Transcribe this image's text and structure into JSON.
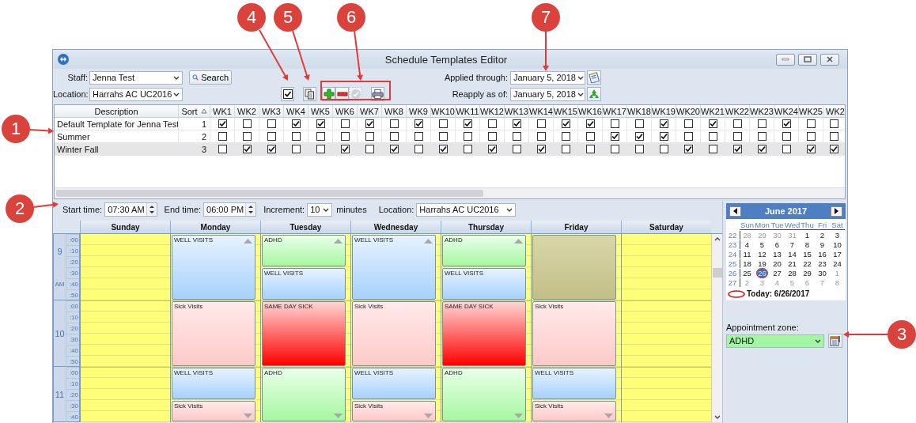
{
  "window": {
    "title": "Schedule Templates Editor"
  },
  "filters": {
    "staff_label": "Staff:",
    "staff": "Jenna Test",
    "search_button": "Search",
    "location_label": "Location:",
    "location": "Harrahs AC UC2016",
    "applied_label": "Applied through:",
    "applied_date": "January 5, 2018",
    "reapply_label": "Reapply as of:",
    "reapply_date": "January 5, 2018"
  },
  "toolbar": [
    {
      "kind": "checkbox",
      "disabled": false
    },
    {
      "kind": "copy",
      "disabled": false
    },
    {
      "kind": "add",
      "disabled": false
    },
    {
      "kind": "remove",
      "disabled": false
    },
    {
      "kind": "approve",
      "disabled": true
    },
    {
      "kind": "print",
      "disabled": false
    }
  ],
  "templates": {
    "columns": [
      "Description",
      "Sort",
      "WK1",
      "WK2",
      "WK3",
      "WK4",
      "WK5",
      "WK6",
      "WK7",
      "WK8",
      "WK9",
      "WK10",
      "WK11",
      "WK12",
      "WK13",
      "WK14",
      "WK15",
      "WK16",
      "WK17",
      "WK18",
      "WK19",
      "WK20",
      "WK21",
      "WK22",
      "WK23",
      "WK24",
      "WK25",
      "WK2"
    ],
    "rows": [
      {
        "description": "Default Template for Jenna Test",
        "sort": "1",
        "selected": false,
        "weeks": [
          true,
          false,
          false,
          true,
          true,
          false,
          true,
          false,
          true,
          false,
          true,
          false,
          true,
          false,
          true,
          true,
          false,
          false,
          true,
          false,
          true,
          false,
          false,
          true,
          false,
          false
        ]
      },
      {
        "description": "Summer",
        "sort": "2",
        "selected": false,
        "weeks": [
          false,
          false,
          false,
          false,
          false,
          false,
          false,
          false,
          false,
          false,
          false,
          false,
          false,
          false,
          false,
          false,
          true,
          true,
          true,
          false,
          false,
          false,
          false,
          false,
          false,
          false
        ]
      },
      {
        "description": "Winter Fall",
        "sort": "3",
        "selected": true,
        "weeks": [
          false,
          true,
          true,
          false,
          false,
          true,
          false,
          true,
          false,
          true,
          false,
          true,
          false,
          true,
          false,
          false,
          false,
          false,
          false,
          true,
          false,
          true,
          true,
          false,
          true,
          true
        ]
      }
    ]
  },
  "schedule_options": {
    "start_label": "Start time:",
    "start": "07:30 AM",
    "end_label": "End time:",
    "end": "06:00 PM",
    "increment_label": "Increment:",
    "increment": "10",
    "unit": "minutes",
    "location_label": "Location:",
    "location": "Harrahs AC UC2016"
  },
  "week": {
    "hours": [
      {
        "label": "9",
        "period": "AM",
        "minutes": [
          ":00",
          ":10",
          ":20",
          ":30",
          ":40",
          ":50"
        ]
      },
      {
        "label": "10",
        "minutes": [
          ":00",
          ":10",
          ":20",
          ":30",
          ":40",
          ":50"
        ]
      },
      {
        "label": "11",
        "minutes": [
          ":00",
          ":10",
          ":20",
          ":30",
          ":40"
        ]
      }
    ],
    "days": [
      {
        "name": "Sunday"
      },
      {
        "name": "Monday",
        "appointments": [
          {
            "label": "WELL VISITS",
            "kind": "well",
            "full_hour": true,
            "more_above": true,
            "more_below": false
          },
          {
            "label": "Sick Visits",
            "kind": "sick",
            "full_hour": true,
            "more_above": false,
            "more_below": false
          },
          {
            "label": "WELL VISITS",
            "kind": "well",
            "full_hour": false,
            "more_above": false,
            "more_below": false
          },
          {
            "label": "Sick Visits",
            "kind": "sick",
            "full_hour": false,
            "more_above": false,
            "more_below": true
          }
        ]
      },
      {
        "name": "Tuesday",
        "appointments": [
          {
            "label": "ADHD",
            "kind": "adhd",
            "full_hour": false,
            "more_above": true,
            "more_below": false
          },
          {
            "label": "WELL VISITS",
            "kind": "well",
            "full_hour": false,
            "more_above": false,
            "more_below": false
          },
          {
            "label": "SAME DAY SICK",
            "kind": "urgent",
            "full_hour": true,
            "more_above": false,
            "more_below": false
          },
          {
            "label": "ADHD",
            "kind": "adhd",
            "full_hour": true,
            "more_above": false,
            "more_below": true
          }
        ]
      },
      {
        "name": "Wednesday",
        "appointments": [
          {
            "label": "WELL VISITS",
            "kind": "well",
            "full_hour": true,
            "more_above": true,
            "more_below": false
          },
          {
            "label": "Sick Visits",
            "kind": "sick",
            "full_hour": true,
            "more_above": false,
            "more_below": false
          },
          {
            "label": "WELL VISITS",
            "kind": "well",
            "full_hour": false,
            "more_above": false,
            "more_below": false
          },
          {
            "label": "Sick Visits",
            "kind": "sick",
            "full_hour": false,
            "more_above": false,
            "more_below": true
          }
        ]
      },
      {
        "name": "Thursday",
        "appointments": [
          {
            "label": "ADHD",
            "kind": "adhd",
            "full_hour": false,
            "more_above": true,
            "more_below": false
          },
          {
            "label": "WELL VISITS",
            "kind": "well",
            "full_hour": false,
            "more_above": false,
            "more_below": false
          },
          {
            "label": "SAME DAY SICK",
            "kind": "urgent",
            "full_hour": true,
            "more_above": false,
            "more_below": false
          },
          {
            "label": "ADHD",
            "kind": "adhd",
            "full_hour": true,
            "more_above": false,
            "more_below": true
          }
        ]
      },
      {
        "name": "Friday",
        "appointments": [
          {
            "kind": "blocked",
            "full_hour": true,
            "more_above": false,
            "more_below": false
          },
          {
            "label": "Sick Visits",
            "kind": "sick",
            "full_hour": true,
            "more_above": false,
            "more_below": false
          },
          {
            "label": "WELL VISITS",
            "kind": "well",
            "full_hour": false,
            "more_above": false,
            "more_below": false
          },
          {
            "label": "Sick Visits",
            "kind": "sick",
            "full_hour": false,
            "more_above": false,
            "more_below": true
          }
        ]
      },
      {
        "name": "Saturday"
      }
    ]
  },
  "calendar": {
    "month": "June 2017",
    "weekdays": [
      "Sun",
      "Mon",
      "Tue",
      "Wed",
      "Thu",
      "Fri",
      "Sat"
    ],
    "weeks": [
      {
        "number": "22",
        "days": [
          {
            "day": "28",
            "other_month": true,
            "selected": false,
            "today": false
          },
          {
            "day": "29",
            "other_month": true,
            "selected": false,
            "today": false
          },
          {
            "day": "30",
            "other_month": true,
            "selected": false,
            "today": false
          },
          {
            "day": "31",
            "other_month": true,
            "selected": false,
            "today": false
          },
          {
            "day": "1",
            "other_month": false,
            "selected": false,
            "today": false
          },
          {
            "day": "2",
            "other_month": false,
            "selected": false,
            "today": false
          },
          {
            "day": "3",
            "other_month": false,
            "selected": false,
            "today": false
          }
        ]
      },
      {
        "number": "23",
        "days": [
          {
            "day": "4",
            "other_month": false,
            "selected": false,
            "today": false
          },
          {
            "day": "5",
            "other_month": false,
            "selected": false,
            "today": false
          },
          {
            "day": "6",
            "other_month": false,
            "selected": false,
            "today": false
          },
          {
            "day": "7",
            "other_month": false,
            "selected": false,
            "today": false
          },
          {
            "day": "8",
            "other_month": false,
            "selected": false,
            "today": false
          },
          {
            "day": "9",
            "other_month": false,
            "selected": false,
            "today": false
          },
          {
            "day": "10",
            "other_month": false,
            "selected": false,
            "today": false
          }
        ]
      },
      {
        "number": "24",
        "days": [
          {
            "day": "11",
            "other_month": false,
            "selected": false,
            "today": false
          },
          {
            "day": "12",
            "other_month": false,
            "selected": false,
            "today": false
          },
          {
            "day": "13",
            "other_month": false,
            "selected": false,
            "today": false
          },
          {
            "day": "14",
            "other_month": false,
            "selected": false,
            "today": false
          },
          {
            "day": "15",
            "other_month": false,
            "selected": false,
            "today": false
          },
          {
            "day": "16",
            "other_month": false,
            "selected": false,
            "today": false
          },
          {
            "day": "17",
            "other_month": false,
            "selected": false,
            "today": false
          }
        ]
      },
      {
        "number": "25",
        "days": [
          {
            "day": "18",
            "other_month": false,
            "selected": false,
            "today": false
          },
          {
            "day": "19",
            "other_month": false,
            "selected": false,
            "today": false
          },
          {
            "day": "20",
            "other_month": false,
            "selected": false,
            "today": false
          },
          {
            "day": "21",
            "other_month": false,
            "selected": false,
            "today": false
          },
          {
            "day": "22",
            "other_month": false,
            "selected": false,
            "today": false
          },
          {
            "day": "23",
            "other_month": false,
            "selected": false,
            "today": false
          },
          {
            "day": "24",
            "other_month": false,
            "selected": false,
            "today": false
          }
        ]
      },
      {
        "number": "26",
        "days": [
          {
            "day": "25",
            "other_month": false,
            "selected": false,
            "today": false
          },
          {
            "day": "26",
            "other_month": false,
            "selected": true,
            "today": true
          },
          {
            "day": "27",
            "other_month": false,
            "selected": false,
            "today": false
          },
          {
            "day": "28",
            "other_month": false,
            "selected": false,
            "today": false
          },
          {
            "day": "29",
            "other_month": false,
            "selected": false,
            "today": false
          },
          {
            "day": "30",
            "other_month": false,
            "selected": false,
            "today": false
          },
          {
            "day": "1",
            "other_month": true,
            "selected": false,
            "today": false
          }
        ]
      },
      {
        "number": "27",
        "days": [
          {
            "day": "2",
            "other_month": true,
            "selected": false,
            "today": false
          },
          {
            "day": "3",
            "other_month": true,
            "selected": false,
            "today": false
          },
          {
            "day": "4",
            "other_month": true,
            "selected": false,
            "today": false
          },
          {
            "day": "5",
            "other_month": true,
            "selected": false,
            "today": false
          },
          {
            "day": "6",
            "other_month": true,
            "selected": false,
            "today": false
          },
          {
            "day": "7",
            "other_month": true,
            "selected": false,
            "today": false
          },
          {
            "day": "8",
            "other_month": true,
            "selected": false,
            "today": false
          }
        ]
      }
    ],
    "today": "Today: 6/26/2017"
  },
  "zone": {
    "label": "Appointment zone:",
    "value": "ADHD",
    "kind": "adhd"
  },
  "callouts": [
    {
      "number": "4"
    },
    {
      "number": "5"
    },
    {
      "number": "6"
    },
    {
      "number": "7"
    },
    {
      "number": "1"
    },
    {
      "number": "2"
    },
    {
      "number": "3"
    }
  ]
}
